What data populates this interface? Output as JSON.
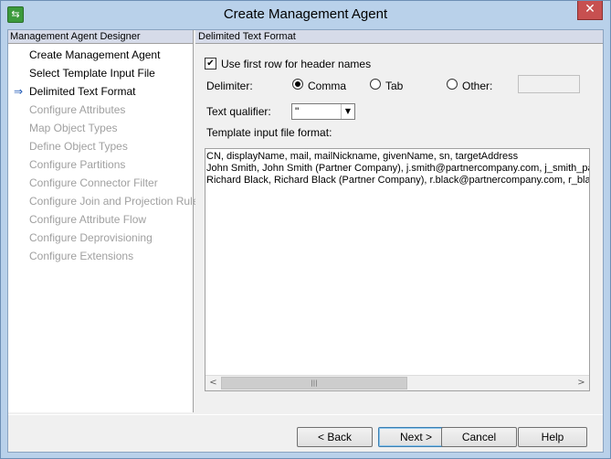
{
  "window": {
    "title": "Create Management Agent",
    "app_icon": "management-agent-icon",
    "close_glyph": "✕"
  },
  "nav": {
    "header": "Management Agent Designer",
    "current_marker_icon": "arrow-right-icon",
    "items": [
      {
        "label": "Create Management Agent",
        "state": "completed"
      },
      {
        "label": "Select Template Input File",
        "state": "completed"
      },
      {
        "label": "Delimited Text Format",
        "state": "current"
      },
      {
        "label": "Configure Attributes",
        "state": "disabled"
      },
      {
        "label": "Map Object Types",
        "state": "disabled"
      },
      {
        "label": "Define Object Types",
        "state": "disabled"
      },
      {
        "label": "Configure Partitions",
        "state": "disabled"
      },
      {
        "label": "Configure Connector Filter",
        "state": "disabled"
      },
      {
        "label": "Configure Join and Projection Rules",
        "state": "disabled"
      },
      {
        "label": "Configure Attribute Flow",
        "state": "disabled"
      },
      {
        "label": "Configure Deprovisioning",
        "state": "disabled"
      },
      {
        "label": "Configure Extensions",
        "state": "disabled"
      }
    ]
  },
  "panel": {
    "header": "Delimited Text Format",
    "header_row_checkbox": {
      "label": "Use first row for header names",
      "checked": true
    },
    "delimiter": {
      "label": "Delimiter:",
      "options": [
        {
          "label": "Comma",
          "selected": true
        },
        {
          "label": "Tab",
          "selected": false
        },
        {
          "label": "Other:",
          "selected": false
        }
      ],
      "other_value": ""
    },
    "text_qualifier": {
      "label": "Text qualifier:",
      "value": "\""
    },
    "template_label": "Template input file format:",
    "template_lines": [
      "CN, displayName, mail, mailNickname, givenName, sn, targetAddress",
      "John Smith, John Smith (Partner Company), j.smith@partnercompany.com, j_smith_partne",
      "Richard Black, Richard Black (Partner Company), r.black@partnercompany.com, r_black"
    ],
    "scroll_position": 0
  },
  "buttons": {
    "back": "< Back",
    "next": "Next >",
    "cancel": "Cancel",
    "help": "Help"
  }
}
